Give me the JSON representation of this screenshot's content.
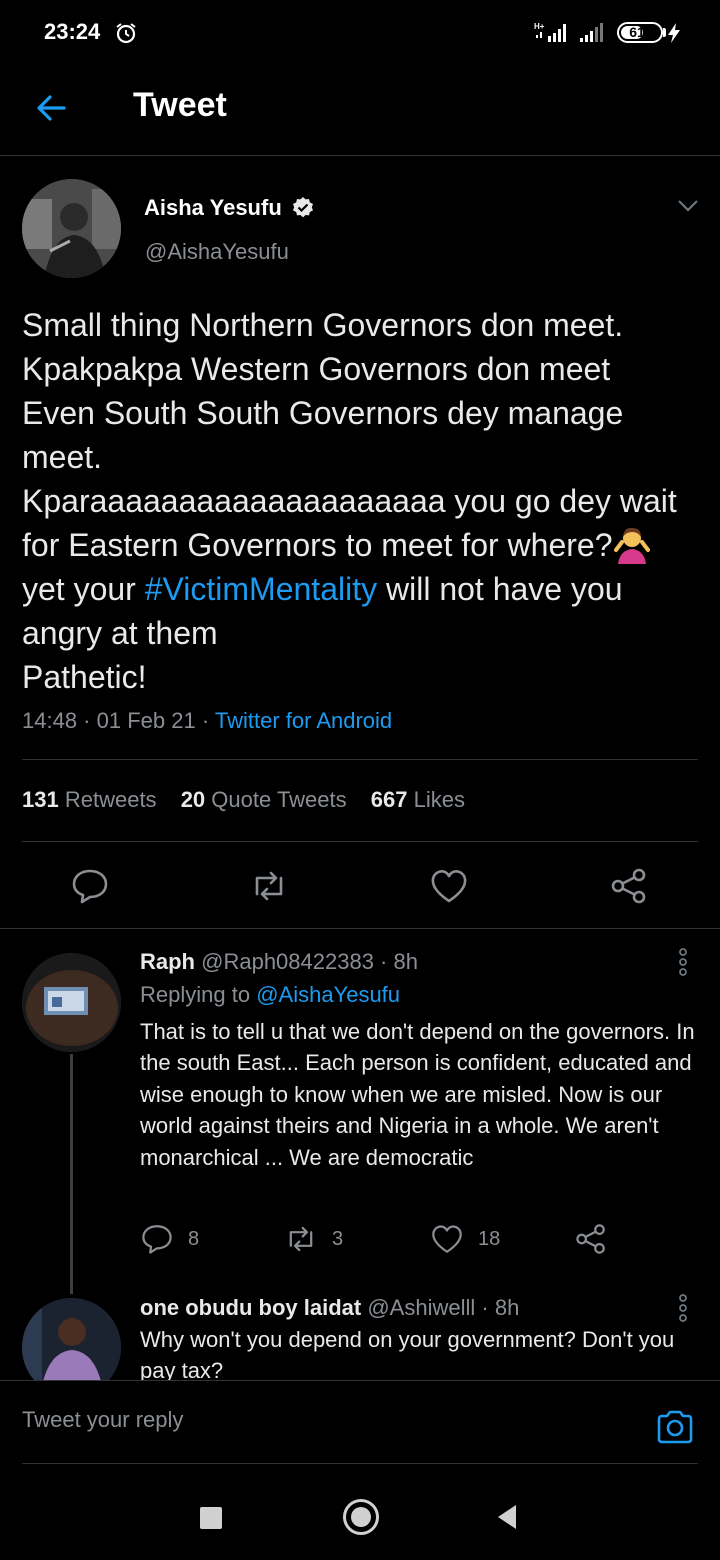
{
  "status_bar": {
    "time": "23:24",
    "battery": "61",
    "battery_level": 0.61
  },
  "header": {
    "title": "Tweet"
  },
  "tweet": {
    "author_name": "Aisha Yesufu",
    "author_handle": "@AishaYesufu",
    "text_part1": "Small thing Northern Governors don meet.\nKpakpakpa Western Governors don meet\nEven South South Governors dey manage meet.\nKparaaaaaaaaaaaaaaaaaaaa you go dey wait for Eastern Governors to meet for where?",
    "text_part2": " yet your ",
    "hashtag": "#VictimMentality",
    "text_part3": " will not have you angry at them\nPathetic!",
    "time": "14:48",
    "date": "01 Feb 21",
    "source": "Twitter for Android",
    "retweets_count": "131",
    "retweets_label": "Retweets",
    "quotes_count": "20",
    "quotes_label": "Quote Tweets",
    "likes_count": "667",
    "likes_label": "Likes"
  },
  "replies": [
    {
      "name": "Raph",
      "handle": "@Raph08422383",
      "time": "8h",
      "replying_label": "Replying to ",
      "replying_to": "@AishaYesufu",
      "text": "That is to tell u that we don't depend on the governors. In the south East... Each person is confident, educated and wise enough to know when we are misled. Now is our world against theirs and Nigeria in a whole. We aren't monarchical ... We are democratic",
      "reply_count": "8",
      "retweet_count": "3",
      "like_count": "18"
    },
    {
      "name": "one obudu boy laidat",
      "handle": "@Ashiwelll",
      "time": "8h",
      "text": "Why won't you depend on your government? Don't you pay tax?"
    }
  ],
  "composer": {
    "placeholder": "Tweet your reply"
  }
}
